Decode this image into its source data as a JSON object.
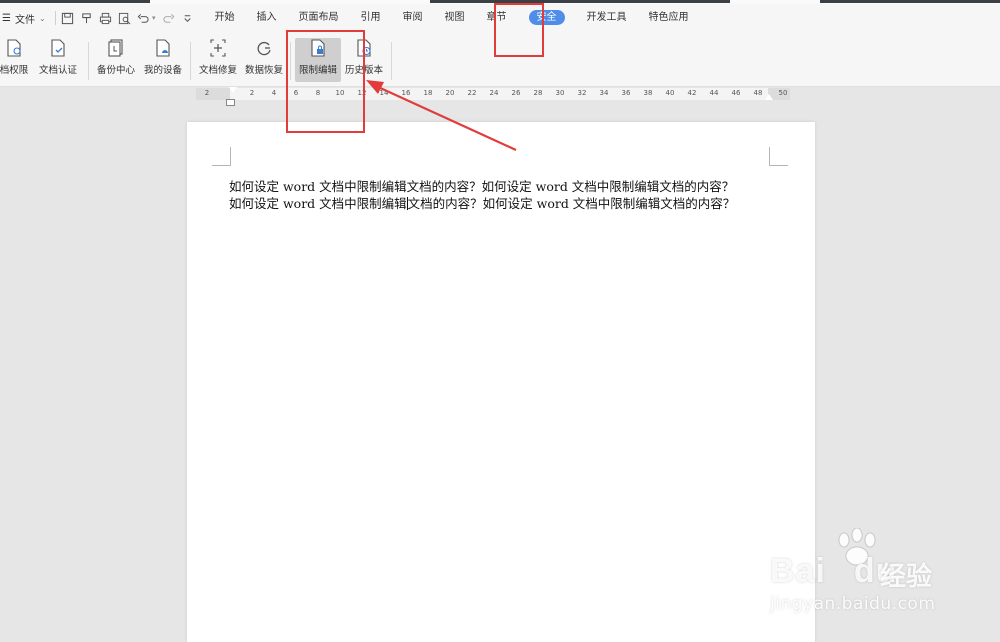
{
  "menu": {
    "file_label": "文件",
    "tabs": [
      {
        "label": "开始"
      },
      {
        "label": "插入"
      },
      {
        "label": "页面布局"
      },
      {
        "label": "引用"
      },
      {
        "label": "审阅"
      },
      {
        "label": "视图"
      },
      {
        "label": "章节"
      },
      {
        "label": "安全"
      },
      {
        "label": "开发工具"
      },
      {
        "label": "特色应用"
      }
    ],
    "active_tab": "安全"
  },
  "ribbon": {
    "buttons": [
      {
        "label": "档权限",
        "icon": "document-permission-icon"
      },
      {
        "label": "文档认证",
        "icon": "document-certify-icon"
      },
      {
        "label": "备份中心",
        "icon": "backup-center-icon"
      },
      {
        "label": "我的设备",
        "icon": "my-device-icon"
      },
      {
        "label": "文档修复",
        "icon": "document-repair-icon"
      },
      {
        "label": "数据恢复",
        "icon": "data-recovery-icon"
      },
      {
        "label": "限制编辑",
        "icon": "restrict-edit-icon"
      },
      {
        "label": "历史版本",
        "icon": "history-version-icon"
      }
    ],
    "selected": "限制编辑"
  },
  "ruler": {
    "ticks": [
      "2",
      "2",
      "4",
      "6",
      "8",
      "10",
      "12",
      "14",
      "16",
      "18",
      "20",
      "22",
      "24",
      "26",
      "28",
      "30",
      "32",
      "34",
      "36",
      "38",
      "40",
      "42",
      "44",
      "46",
      "48",
      "50"
    ]
  },
  "document": {
    "line1": "如何设定 word 文档中限制编辑文档的内容？如何设定 word 文档中限制编辑文档的内容？",
    "line2_before_caret": "如何设定 word 文档中限制编辑",
    "line2_after_caret": "文档的内容？如何设定 word 文档中限制编辑文档的内容？"
  },
  "watermark": {
    "logo": "Bai",
    "logo_tail": "du",
    "cn": "经验",
    "url": "jingyan.baidu.com"
  },
  "colors": {
    "accent": "#4f8de8",
    "annotation": "#e23b3b"
  }
}
